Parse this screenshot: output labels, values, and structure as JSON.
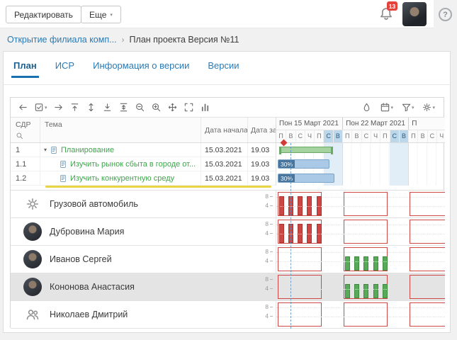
{
  "topbar": {
    "edit_button": "Редактировать",
    "more_button": "Еще",
    "notification_badge": "13",
    "help_button": "?"
  },
  "breadcrumb": {
    "parent_link": "Открытие филиала комп...",
    "separator": "›",
    "current": "План проекта Версия №11"
  },
  "tabs": [
    {
      "label": "План",
      "active": true
    },
    {
      "label": "ИСР",
      "active": false
    },
    {
      "label": "Информация о версии",
      "active": false
    },
    {
      "label": "Версии",
      "active": false
    }
  ],
  "toolbar": {
    "left": [
      {
        "name": "arrow-left-icon"
      },
      {
        "name": "select-tasks-icon",
        "caret": true
      },
      {
        "name": "arrow-right-icon"
      },
      {
        "name": "collapse-top-icon"
      },
      {
        "name": "expand-rows-icon"
      },
      {
        "name": "collapse-bottom-icon"
      },
      {
        "name": "fit-rows-icon"
      },
      {
        "name": "zoom-out-icon"
      },
      {
        "name": "zoom-in-icon"
      },
      {
        "name": "pan-icon"
      },
      {
        "name": "fullscreen-icon"
      },
      {
        "name": "histogram-icon"
      }
    ],
    "right": [
      {
        "name": "critical-path-icon"
      },
      {
        "name": "calendar-icon",
        "caret": true
      },
      {
        "name": "filter-icon",
        "caret": true
      },
      {
        "name": "settings-icon",
        "caret": true
      }
    ]
  },
  "table": {
    "columns": {
      "wbs": "СДР",
      "topic": "Тема",
      "start": "Дата начала",
      "end": "Дата заве"
    },
    "rows": [
      {
        "wbs": "1",
        "topic": "Планирование",
        "start": "15.03.2021",
        "end": "19.03",
        "group": true
      },
      {
        "wbs": "1.1",
        "topic": "Изучить рынок сбыта в городе от...",
        "start": "15.03.2021",
        "end": "19.03"
      },
      {
        "wbs": "1.2",
        "topic": "Изучить конкурентную среду",
        "start": "15.03.2021",
        "end": "19.03"
      }
    ]
  },
  "timeline": {
    "weeks": [
      {
        "label": "Пон 15 Март 2021",
        "days": [
          "П",
          "В",
          "С",
          "Ч",
          "П",
          "С",
          "В"
        ]
      },
      {
        "label": "Пон 22 Март 2021",
        "days": [
          "П",
          "В",
          "С",
          "Ч",
          "П",
          "С",
          "В"
        ]
      },
      {
        "label": "П",
        "days": [
          "П",
          "В",
          "С",
          "Ч"
        ]
      }
    ],
    "bars": [
      {
        "row": "1",
        "type": "summary"
      },
      {
        "row": "1.1",
        "type": "task",
        "progress": "30%"
      },
      {
        "row": "1.2",
        "type": "task",
        "progress": "30%"
      }
    ]
  },
  "resources": {
    "axis_labels": [
      "8",
      "4"
    ],
    "rows": [
      {
        "name": "Грузовой автомобиль",
        "icon": "gear-icon",
        "selected": false,
        "load": {
          "blocks": [
            [
              0,
              5
            ],
            [
              7,
              5
            ],
            [
              14,
              5
            ]
          ],
          "bars": [
            [
              0,
              8,
              "red"
            ],
            [
              1,
              8,
              "red"
            ],
            [
              2,
              8,
              "red"
            ],
            [
              3,
              8,
              "red"
            ],
            [
              4,
              8,
              "red"
            ]
          ]
        }
      },
      {
        "name": "Дубровина Мария",
        "icon": "avatar",
        "selected": false,
        "load": {
          "blocks": [
            [
              0,
              5
            ],
            [
              7,
              5
            ],
            [
              14,
              5
            ]
          ],
          "bars": [
            [
              0,
              8,
              "red"
            ],
            [
              1,
              8,
              "red"
            ],
            [
              2,
              8,
              "red"
            ],
            [
              3,
              8,
              "red"
            ],
            [
              4,
              8,
              "red"
            ]
          ]
        }
      },
      {
        "name": "Иванов Сергей",
        "icon": "avatar",
        "selected": false,
        "load": {
          "blocks": [
            [
              0,
              5
            ],
            [
              7,
              5
            ],
            [
              14,
              5
            ]
          ],
          "bars": [
            [
              7,
              6,
              "green"
            ],
            [
              8,
              6,
              "green"
            ],
            [
              9,
              6,
              "green"
            ],
            [
              10,
              6,
              "green"
            ],
            [
              11,
              6,
              "green"
            ]
          ]
        }
      },
      {
        "name": "Кононова Анастасия",
        "icon": "avatar",
        "selected": true,
        "load": {
          "blocks": [
            [
              0,
              5
            ],
            [
              7,
              5
            ],
            [
              14,
              5
            ]
          ],
          "bars": [
            [
              7,
              6,
              "green"
            ],
            [
              8,
              6,
              "green"
            ],
            [
              9,
              6,
              "green"
            ],
            [
              10,
              6,
              "green"
            ],
            [
              11,
              6,
              "green"
            ]
          ]
        }
      },
      {
        "name": "Николаев Дмитрий",
        "icon": "group-icon",
        "selected": false,
        "load": {
          "blocks": [
            [
              0,
              5
            ],
            [
              7,
              5
            ],
            [
              14,
              5
            ]
          ],
          "bars": []
        }
      }
    ]
  }
}
